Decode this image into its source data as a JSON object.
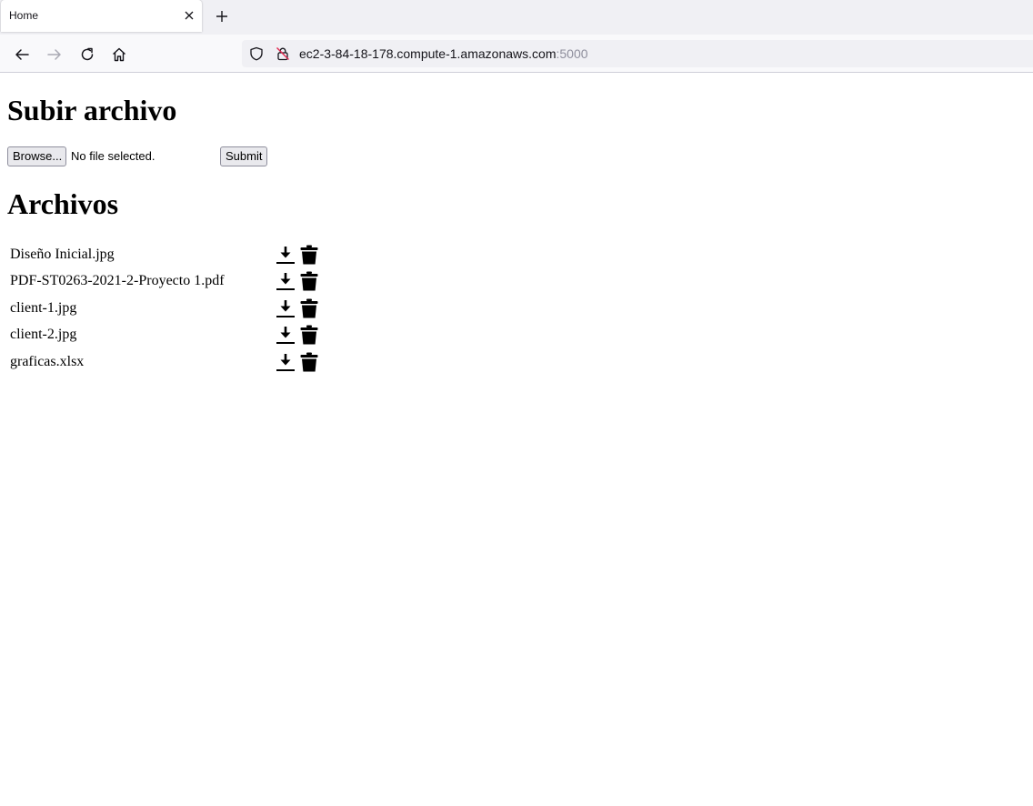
{
  "browser": {
    "tab_title": "Home",
    "url_host": "ec2-3-84-18-178.compute-1.amazonaws.com",
    "url_port": ":5000"
  },
  "page": {
    "upload_heading": "Subir archivo",
    "browse_label": "Browse...",
    "file_status": "No file selected.",
    "submit_label": "Submit",
    "files_heading": "Archivos",
    "files": [
      {
        "name": "Diseño Inicial.jpg"
      },
      {
        "name": "PDF-ST0263-2021-2-Proyecto 1.pdf"
      },
      {
        "name": "client-1.jpg"
      },
      {
        "name": "client-2.jpg"
      },
      {
        "name": "graficas.xlsx"
      }
    ]
  },
  "icons": {
    "download": "download-icon",
    "delete": "trash-icon"
  }
}
